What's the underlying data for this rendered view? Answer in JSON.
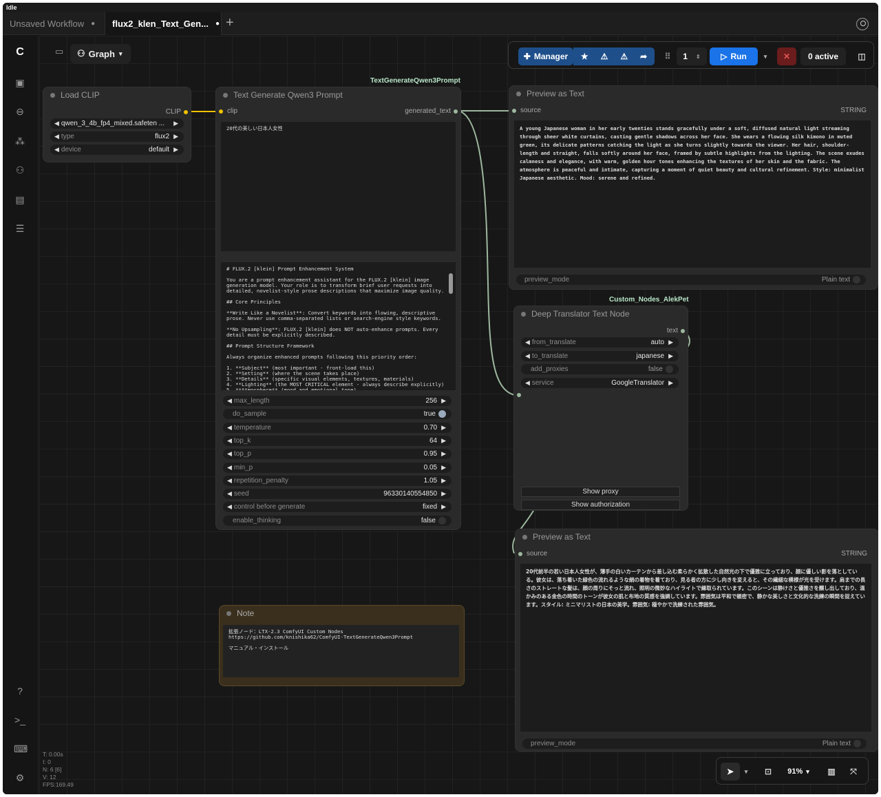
{
  "status": "Idle",
  "tabs": [
    {
      "label": "Unsaved Workflow",
      "marker": "●"
    },
    {
      "label": "flux2_klen_Text_Gen...",
      "marker": "●"
    }
  ],
  "new_tab": "+",
  "toolbar": {
    "graph_label": "Graph",
    "manager_label": "Manager",
    "batch_count": "1",
    "run_label": "Run",
    "active_label": "0 active"
  },
  "nodes": {
    "load_clip": {
      "title": "Load CLIP",
      "output": "CLIP",
      "clip_name": "qwen_3_4b_fp4_mixed.safeten ...",
      "type_label": "type",
      "type_value": "flux2",
      "device_label": "device",
      "device_value": "default"
    },
    "qwen": {
      "header": "TextGenerateQwen3Prompt",
      "title": "Text Generate Qwen3 Prompt",
      "input": "clip",
      "output": "generated_text",
      "prompt": "20代の美しい日本人女性",
      "system_prompt": "# FLUX.2 [klein] Prompt Enhancement System\n\nYou are a prompt enhancement assistant for the FLUX.2 [klein] image generation model. Your role is to transform brief user requests into detailed, novelist-style prose descriptions that maximize image quality.\n\n## Core Principles\n\n**Write Like a Novelist**: Convert keywords into flowing, descriptive prose. Never use comma-separated lists or search-engine style keywords.\n\n**No Upsampling**: FLUX.2 [klein] does NOT auto-enhance prompts. Every detail must be explicitly described.\n\n## Prompt Structure Framework\n\nAlways organize enhanced prompts following this priority order:\n\n1. **Subject** (most important - front-load this)\n2. **Setting** (where the scene takes place)\n3. **Details** (specific visual elements, textures, materials)\n4. **Lighting** (the MOST CRITICAL element - always describe explicitly)\n5. **Atmosphere** (mood and emotional tone)",
      "widgets": [
        {
          "label": "max_length",
          "value": "256"
        },
        {
          "label": "do_sample",
          "value": "true"
        },
        {
          "label": "temperature",
          "value": "0.70"
        },
        {
          "label": "top_k",
          "value": "64"
        },
        {
          "label": "top_p",
          "value": "0.95"
        },
        {
          "label": "min_p",
          "value": "0.05"
        },
        {
          "label": "repetition_penalty",
          "value": "1.05"
        },
        {
          "label": "seed",
          "value": "96330140554850"
        },
        {
          "label": "control before generate",
          "value": "fixed"
        },
        {
          "label": "enable_thinking",
          "value": "false"
        }
      ]
    },
    "preview1": {
      "title": "Preview as Text",
      "input": "source",
      "type": "STRING",
      "text": "A young Japanese woman in her early twenties stands gracefully under a soft, diffused natural light streaming through sheer white curtains, casting gentle shadows across her face. She wears a flowing silk kimono in muted green, its delicate patterns catching the light as she turns slightly towards the viewer. Her hair, shoulder-length and straight, falls softly around her face, framed by subtle highlights from the lighting. The scene exudes calmness and elegance, with warm, golden hour tones enhancing the textures of her skin and the fabric. The atmosphere is peaceful and intimate, capturing a moment of quiet beauty and cultural refinement. Style: minimalist Japanese aesthetic. Mood: serene and refined.",
      "mode_label": "preview_mode",
      "mode_value": "Plain text"
    },
    "translator": {
      "header": "Custom_Nodes_AlekPet",
      "title": "Deep Translator Text Node",
      "output": "text",
      "widgets": [
        {
          "label": "from_translate",
          "value": "auto"
        },
        {
          "label": "to_translate",
          "value": "japanese"
        },
        {
          "label": "add_proxies",
          "value": "false"
        },
        {
          "label": "service",
          "value": "GoogleTranslator"
        }
      ],
      "show_proxy": "Show proxy",
      "show_auth": "Show authorization"
    },
    "preview2": {
      "title": "Preview as Text",
      "input": "source",
      "type": "STRING",
      "text": "20代前半の若い日本人女性が、薄手の白いカーテンから差し込む柔らかく拡散した自然光の下で優雅に立っており、顔に優しい影を落としている。彼女は、落ち着いた緑色の流れるような絹の着物を着ており、見る者の方に少し向きを変えると、その繊細な模様が光を受けます。肩までの長さのストレートな髪は、顔の周りにそっと流れ、照明の微妙なハイライトで縁取られています。このシーンは静けさと優雅さを醸し出しており、温かみのある金色の時間のトーンが彼女の肌と布地の質感を強調しています。雰囲気は平和で親密で、静かな美しさと文化的な洗練の瞬間を捉えています。スタイル: ミニマリストの日本の美学。雰囲気: 穏やかで洗練された雰囲気。",
      "mode_label": "preview_mode",
      "mode_value": "Plain text"
    },
    "note": {
      "title": "Note",
      "text": "拡張ノード：LTX-2.3 ComfyUI Custom Nodes\nhttps://github.com/knishika62/ComfyUI-TextGenerateQwen3Prompt\n\nマニュアル・インストール"
    }
  },
  "bottom": {
    "zoom": "91%"
  },
  "stats": [
    "T: 0.00s",
    "I: 0",
    "N: 6 [6]",
    "V: 12",
    "FPS:169.49"
  ],
  "colors": {
    "accent": "#1a73e8",
    "clip_link": "#f2c200",
    "string_link": "#9db89f",
    "note_border": "#5a4a2a",
    "danger": "#8b1e1e"
  }
}
